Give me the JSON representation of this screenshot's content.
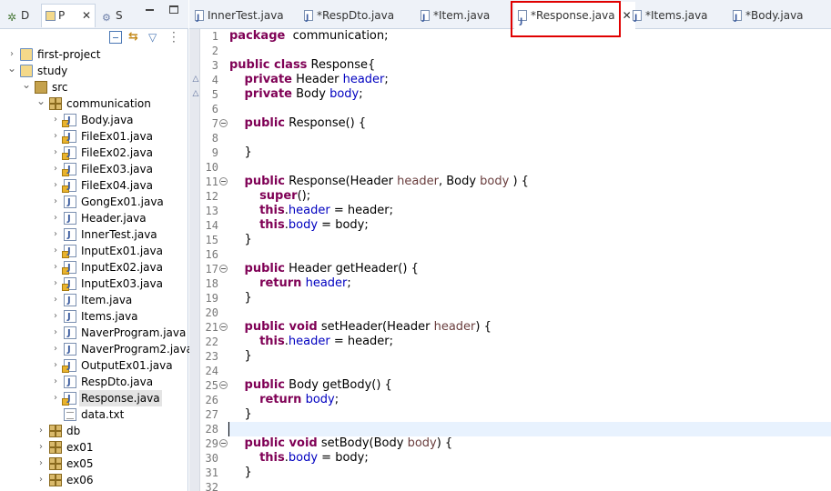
{
  "left_panel": {
    "tabs": [
      {
        "label": "D",
        "icon": "debug-icon"
      },
      {
        "label": "P",
        "icon": "package-explorer-icon"
      },
      {
        "label": "S",
        "icon": "servers-icon"
      }
    ],
    "tree": [
      {
        "label": "first-project",
        "depth": 0,
        "expanded": false,
        "icon": "project-icon"
      },
      {
        "label": "study",
        "depth": 0,
        "expanded": true,
        "icon": "project-icon"
      },
      {
        "label": "src",
        "depth": 1,
        "expanded": true,
        "icon": "source-folder-icon"
      },
      {
        "label": "communication",
        "depth": 2,
        "expanded": true,
        "icon": "package-icon"
      },
      {
        "label": "Body.java",
        "depth": 3,
        "icon": "java-file-icon",
        "warn": true
      },
      {
        "label": "FileEx01.java",
        "depth": 3,
        "icon": "java-file-icon",
        "warn": true
      },
      {
        "label": "FileEx02.java",
        "depth": 3,
        "icon": "java-file-icon",
        "warn": true
      },
      {
        "label": "FileEx03.java",
        "depth": 3,
        "icon": "java-file-icon",
        "warn": true
      },
      {
        "label": "FileEx04.java",
        "depth": 3,
        "icon": "java-file-icon",
        "warn": true
      },
      {
        "label": "GongEx01.java",
        "depth": 3,
        "icon": "java-file-icon",
        "warn": false
      },
      {
        "label": "Header.java",
        "depth": 3,
        "icon": "java-file-icon",
        "warn": false
      },
      {
        "label": "InnerTest.java",
        "depth": 3,
        "icon": "java-file-icon",
        "warn": false
      },
      {
        "label": "InputEx01.java",
        "depth": 3,
        "icon": "java-file-icon",
        "warn": true
      },
      {
        "label": "InputEx02.java",
        "depth": 3,
        "icon": "java-file-icon",
        "warn": true
      },
      {
        "label": "InputEx03.java",
        "depth": 3,
        "icon": "java-file-icon",
        "warn": true
      },
      {
        "label": "Item.java",
        "depth": 3,
        "icon": "java-file-icon",
        "warn": false
      },
      {
        "label": "Items.java",
        "depth": 3,
        "icon": "java-file-icon",
        "warn": false
      },
      {
        "label": "NaverProgram.java",
        "depth": 3,
        "icon": "java-file-icon",
        "warn": false
      },
      {
        "label": "NaverProgram2.java",
        "depth": 3,
        "icon": "java-file-icon",
        "warn": false
      },
      {
        "label": "OutputEx01.java",
        "depth": 3,
        "icon": "java-file-icon",
        "warn": true
      },
      {
        "label": "RespDto.java",
        "depth": 3,
        "icon": "java-file-icon",
        "warn": false
      },
      {
        "label": "Response.java",
        "depth": 3,
        "icon": "java-file-icon",
        "warn": true,
        "selected": true
      },
      {
        "label": "data.txt",
        "depth": 3,
        "icon": "text-file-icon",
        "nochev": true
      },
      {
        "label": "db",
        "depth": 2,
        "expanded": false,
        "icon": "package-icon"
      },
      {
        "label": "ex01",
        "depth": 2,
        "expanded": false,
        "icon": "package-icon"
      },
      {
        "label": "ex05",
        "depth": 2,
        "expanded": false,
        "icon": "package-icon"
      },
      {
        "label": "ex06",
        "depth": 2,
        "expanded": false,
        "icon": "package-icon"
      }
    ]
  },
  "editor": {
    "tabs": [
      {
        "label": "InnerTest.java",
        "active": false
      },
      {
        "label": "*RespDto.java",
        "active": false
      },
      {
        "label": "*Item.java",
        "active": false
      },
      {
        "label": "*Response.java",
        "active": true
      },
      {
        "label": "*Items.java",
        "active": false
      },
      {
        "label": "*Body.java",
        "active": false
      }
    ],
    "current_line": 28,
    "lines": [
      {
        "n": "1",
        "fold": false,
        "t": [
          [
            "kw",
            "package"
          ],
          [
            "",
            "  communication;"
          ]
        ]
      },
      {
        "n": "2",
        "fold": false,
        "t": []
      },
      {
        "n": "3",
        "fold": false,
        "t": [
          [
            "kw",
            "public class"
          ],
          [
            "",
            " Response{"
          ]
        ]
      },
      {
        "n": "4",
        "fold": false,
        "t": [
          [
            "",
            "    "
          ],
          [
            "kw",
            "private"
          ],
          [
            "",
            " Header "
          ],
          [
            "fld",
            "header"
          ],
          [
            "",
            ";"
          ]
        ]
      },
      {
        "n": "5",
        "fold": false,
        "t": [
          [
            "",
            "    "
          ],
          [
            "kw",
            "private"
          ],
          [
            "",
            " Body "
          ],
          [
            "fld",
            "body"
          ],
          [
            "",
            ";"
          ]
        ]
      },
      {
        "n": "6",
        "fold": false,
        "t": []
      },
      {
        "n": "7",
        "fold": true,
        "t": [
          [
            "",
            "    "
          ],
          [
            "kw",
            "public"
          ],
          [
            "",
            " Response() {"
          ]
        ]
      },
      {
        "n": "8",
        "fold": false,
        "t": []
      },
      {
        "n": "9",
        "fold": false,
        "t": [
          [
            "",
            "    }"
          ]
        ]
      },
      {
        "n": "10",
        "fold": false,
        "t": []
      },
      {
        "n": "11",
        "fold": true,
        "t": [
          [
            "",
            "    "
          ],
          [
            "kw",
            "public"
          ],
          [
            "",
            " Response(Header "
          ],
          [
            "prm",
            "header"
          ],
          [
            "",
            ", Body "
          ],
          [
            "prm",
            "body"
          ],
          [
            "",
            " ) {"
          ]
        ]
      },
      {
        "n": "12",
        "fold": false,
        "t": [
          [
            "",
            "        "
          ],
          [
            "kw",
            "super"
          ],
          [
            "",
            "();"
          ]
        ]
      },
      {
        "n": "13",
        "fold": false,
        "t": [
          [
            "",
            "        "
          ],
          [
            "kw",
            "this"
          ],
          [
            "",
            "."
          ],
          [
            "fld",
            "header"
          ],
          [
            "",
            " = header;"
          ]
        ]
      },
      {
        "n": "14",
        "fold": false,
        "t": [
          [
            "",
            "        "
          ],
          [
            "kw",
            "this"
          ],
          [
            "",
            "."
          ],
          [
            "fld",
            "body"
          ],
          [
            "",
            " = body;"
          ]
        ]
      },
      {
        "n": "15",
        "fold": false,
        "t": [
          [
            "",
            "    }"
          ]
        ]
      },
      {
        "n": "16",
        "fold": false,
        "t": []
      },
      {
        "n": "17",
        "fold": true,
        "t": [
          [
            "",
            "    "
          ],
          [
            "kw",
            "public"
          ],
          [
            "",
            " Header getHeader() {"
          ]
        ]
      },
      {
        "n": "18",
        "fold": false,
        "t": [
          [
            "",
            "        "
          ],
          [
            "kw",
            "return"
          ],
          [
            "",
            " "
          ],
          [
            "fld",
            "header"
          ],
          [
            "",
            ";"
          ]
        ]
      },
      {
        "n": "19",
        "fold": false,
        "t": [
          [
            "",
            "    }"
          ]
        ]
      },
      {
        "n": "20",
        "fold": false,
        "t": []
      },
      {
        "n": "21",
        "fold": true,
        "t": [
          [
            "",
            "    "
          ],
          [
            "kw",
            "public void"
          ],
          [
            "",
            " setHeader(Header "
          ],
          [
            "prm",
            "header"
          ],
          [
            "",
            ") {"
          ]
        ]
      },
      {
        "n": "22",
        "fold": false,
        "t": [
          [
            "",
            "        "
          ],
          [
            "kw",
            "this"
          ],
          [
            "",
            "."
          ],
          [
            "fld",
            "header"
          ],
          [
            "",
            " = header;"
          ]
        ]
      },
      {
        "n": "23",
        "fold": false,
        "t": [
          [
            "",
            "    }"
          ]
        ]
      },
      {
        "n": "24",
        "fold": false,
        "t": []
      },
      {
        "n": "25",
        "fold": true,
        "t": [
          [
            "",
            "    "
          ],
          [
            "kw",
            "public"
          ],
          [
            "",
            " Body getBody() {"
          ]
        ]
      },
      {
        "n": "26",
        "fold": false,
        "t": [
          [
            "",
            "        "
          ],
          [
            "kw",
            "return"
          ],
          [
            "",
            " "
          ],
          [
            "fld",
            "body"
          ],
          [
            "",
            ";"
          ]
        ]
      },
      {
        "n": "27",
        "fold": false,
        "t": [
          [
            "",
            "    }"
          ]
        ]
      },
      {
        "n": "28",
        "fold": false,
        "t": []
      },
      {
        "n": "29",
        "fold": true,
        "t": [
          [
            "",
            "    "
          ],
          [
            "kw",
            "public void"
          ],
          [
            "",
            " setBody(Body "
          ],
          [
            "prm",
            "body"
          ],
          [
            "",
            ") {"
          ]
        ]
      },
      {
        "n": "30",
        "fold": false,
        "t": [
          [
            "",
            "        "
          ],
          [
            "kw",
            "this"
          ],
          [
            "",
            "."
          ],
          [
            "fld",
            "body"
          ],
          [
            "",
            " = body;"
          ]
        ]
      },
      {
        "n": "31",
        "fold": false,
        "t": [
          [
            "",
            "    }"
          ]
        ]
      },
      {
        "n": "32",
        "fold": false,
        "t": []
      }
    ]
  },
  "colors": {
    "keyword": "#7f0055",
    "field": "#0000c0",
    "parameter": "#6a3e3e",
    "current_line": "#e8f2fe",
    "highlight_box": "#e00000"
  }
}
